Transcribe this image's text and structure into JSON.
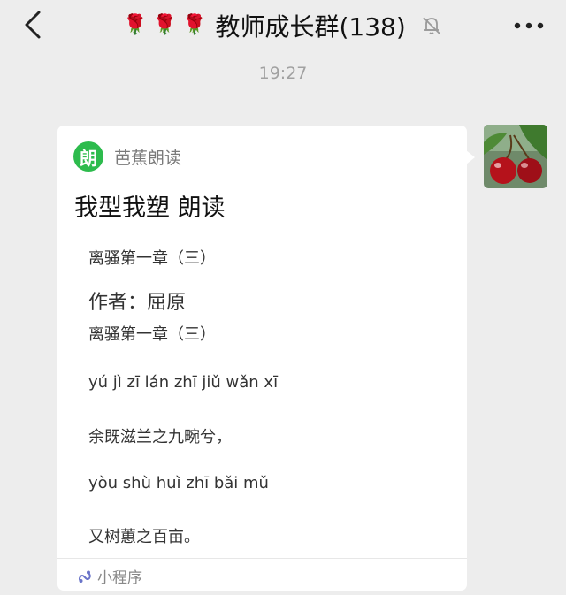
{
  "header": {
    "title": "教师成长群(138)",
    "roses": [
      "🌹",
      "🌹",
      "🌹"
    ],
    "back_icon": "chevron-left-icon",
    "mute_icon": "bell-off-icon",
    "more_icon": "more-dots-icon"
  },
  "timestamp": "19:27",
  "message": {
    "app_logo_text": "朗",
    "app_name": "芭蕉朗读",
    "title": "我型我塑 朗读",
    "preview_lines": [
      "离骚第一章（三）",
      "作者：屈原",
      "离骚第一章（三）",
      "yú jì zī lán zhī jiǔ wǎn xī",
      "余既滋兰之九畹兮，",
      "yòu shù huì zhī bǎi mǔ",
      "又树蕙之百亩。"
    ],
    "footer_label": "小程序",
    "footer_icon": "mini-program-icon"
  },
  "colors": {
    "background": "#ededed",
    "card": "#ffffff",
    "accent_green": "#2dbb4d"
  }
}
